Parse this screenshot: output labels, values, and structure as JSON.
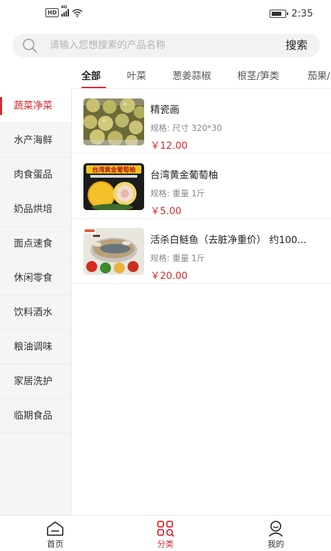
{
  "status_bar": {
    "hd_label": "HD",
    "network_label": "4G",
    "time": "2:35",
    "battery_level": 0.75
  },
  "search": {
    "placeholder": "请输入您想搜索的产品名称",
    "button_label": "搜索"
  },
  "tabs": [
    {
      "label": "全部",
      "active": true
    },
    {
      "label": "叶菜",
      "active": false
    },
    {
      "label": "葱姜蒜椒",
      "active": false
    },
    {
      "label": "根茎/笋类",
      "active": false
    },
    {
      "label": "茄果/",
      "active": false
    }
  ],
  "sidebar": {
    "items": [
      {
        "label": "蔬菜净菜",
        "active": true
      },
      {
        "label": "水产海鲜",
        "active": false
      },
      {
        "label": "肉食蛋品",
        "active": false
      },
      {
        "label": "奶品烘培",
        "active": false
      },
      {
        "label": "面点速食",
        "active": false
      },
      {
        "label": "休闲零食",
        "active": false
      },
      {
        "label": "饮料酒水",
        "active": false
      },
      {
        "label": "粮油调味",
        "active": false
      },
      {
        "label": "家居洗护",
        "active": false
      },
      {
        "label": "临期食品",
        "active": false
      }
    ]
  },
  "products": [
    {
      "name": "精瓷画",
      "spec": "规格:  尺寸 320*30",
      "price": "￥12.00",
      "image_icon": "apples-photo"
    },
    {
      "name": "台湾黄金葡萄柚",
      "spec": "规格:  重量 1斤",
      "price": "￥5.00",
      "image_icon": "grapefruit-photo",
      "image_banner": "台湾黄金葡萄柚"
    },
    {
      "name": "活杀白鲢鱼（去脏净重价） 约100...",
      "spec": "规格:  重量 1斤",
      "price": "￥20.00",
      "image_icon": "fish-dish-photo"
    }
  ],
  "bottom_nav": [
    {
      "label": "首页",
      "icon": "home-icon",
      "active": false
    },
    {
      "label": "分类",
      "icon": "category-icon",
      "active": true
    },
    {
      "label": "我的",
      "icon": "user-icon",
      "active": false
    }
  ],
  "colors": {
    "accent": "#d9262d",
    "sidebar_bg": "#f5f5f5",
    "search_bg": "#f2f2f2"
  }
}
